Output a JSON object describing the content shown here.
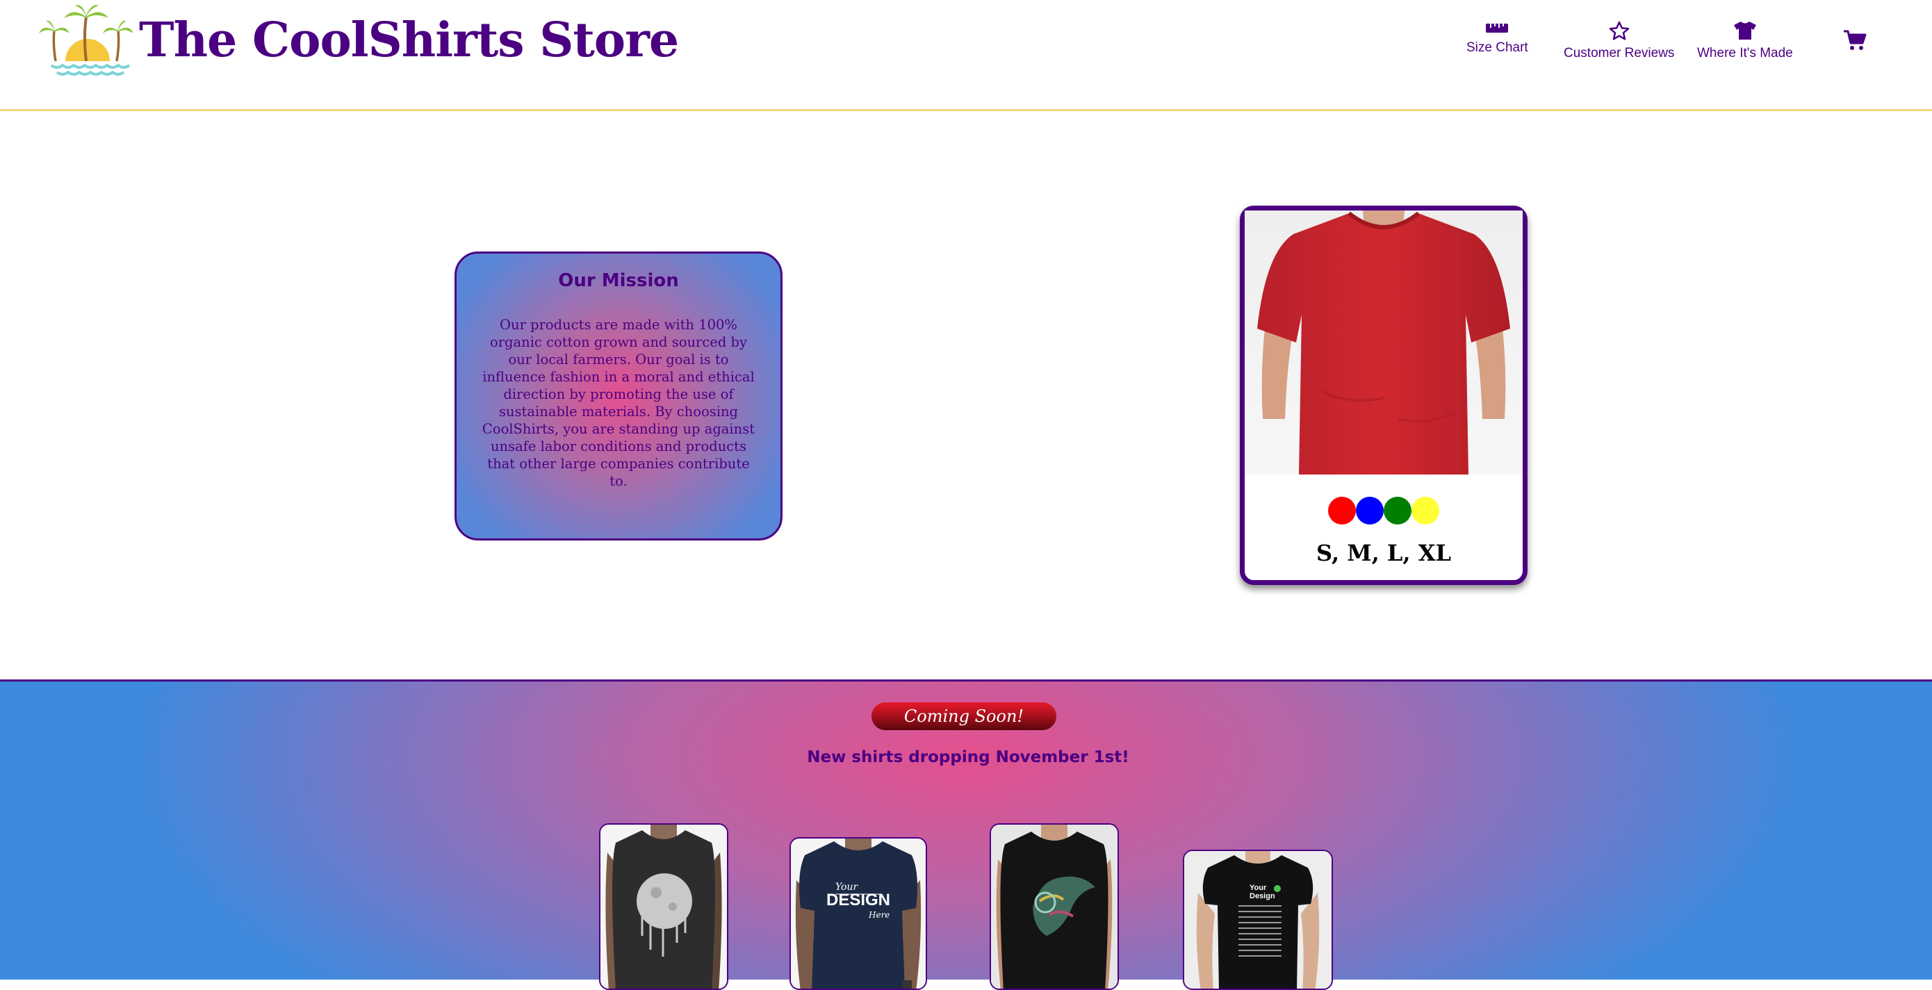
{
  "header": {
    "brand": "The CoolShirts Store",
    "nav": {
      "size_chart": "Size Chart",
      "customer_reviews": "Customer Reviews",
      "where_made": "Where It's Made"
    }
  },
  "mission": {
    "title": "Our Mission",
    "body": "Our products are made with 100% organic cotton grown and sourced by our local farmers. Our goal is to influence fashion in a moral and ethical direction by promoting the use of sustainable materials. By choosing CoolShirts, you are standing up against unsafe labor conditions and products that other large companies contribute to."
  },
  "product": {
    "colors": [
      "#ff0000",
      "#0000ff",
      "#008000",
      "#ffff33"
    ],
    "sizes": "S, M, L, XL"
  },
  "coming_soon": {
    "button": "Coming Soon!",
    "subtitle": "New shirts dropping November 1st!",
    "shirt_print_text": [
      "Your",
      "DESIGN",
      "Here",
      "Your",
      "Design"
    ]
  },
  "colors": {
    "brand_purple": "#4b0082",
    "header_border": "#f0d67a"
  }
}
